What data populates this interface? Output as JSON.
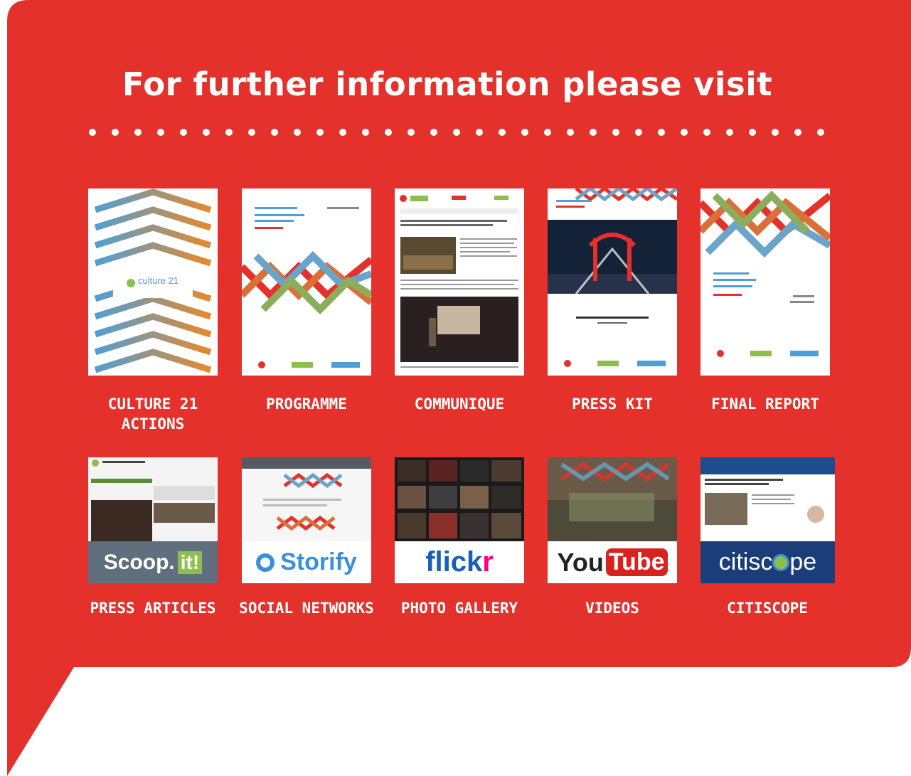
{
  "title": "For further information please visit",
  "colors": {
    "background": "#e4312b",
    "text": "#ffffff"
  },
  "documents": [
    {
      "label_line1": "CULTURE 21",
      "label_line2": "ACTIONS",
      "cover_text": "culture 21"
    },
    {
      "label_line1": "PROGRAMME",
      "label_line2": ""
    },
    {
      "label_line1": "COMMUNIQUE",
      "label_line2": ""
    },
    {
      "label_line1": "PRESS KIT",
      "label_line2": ""
    },
    {
      "label_line1": "FINAL REPORT",
      "label_line2": ""
    }
  ],
  "links": [
    {
      "label": "PRESS ARTICLES",
      "brand_a": "Scoop.",
      "brand_b": "it!"
    },
    {
      "label": "SOCIAL  NETWORKS",
      "brand": "Storify"
    },
    {
      "label": "PHOTO GALLERY",
      "brand_a": "flick",
      "brand_b": "r"
    },
    {
      "label": "VIDEOS",
      "brand_a": "You",
      "brand_b": "Tube"
    },
    {
      "label": "CITISCOPE",
      "brand_a": "citisc",
      "brand_b": "pe"
    }
  ]
}
